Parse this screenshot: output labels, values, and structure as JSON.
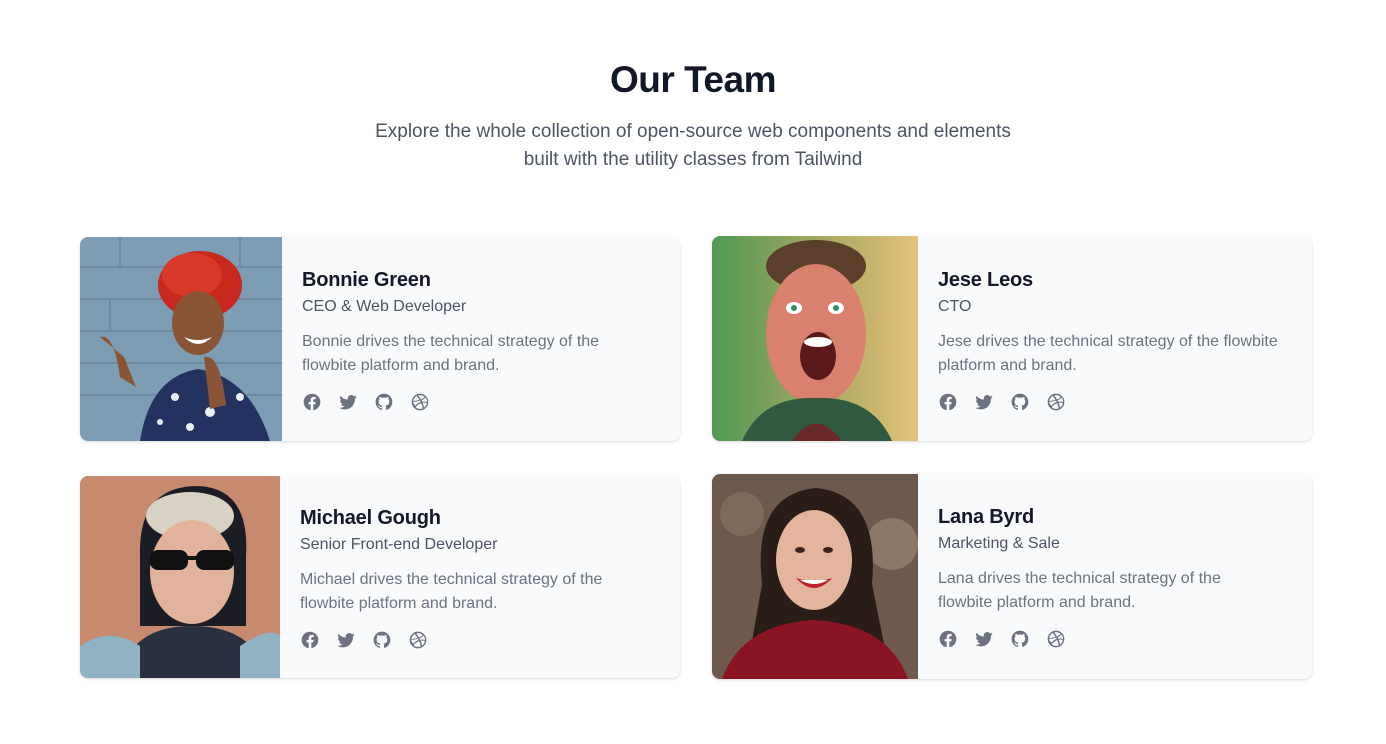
{
  "header": {
    "title": "Our Team",
    "subtitle": "Explore the whole collection of open-source web components and elements built with the utility classes from Tailwind"
  },
  "members": [
    {
      "name": "Bonnie Green",
      "role": "CEO & Web Developer",
      "description": "Bonnie drives the technical strategy of the flowbite platform and brand.",
      "socials": [
        "facebook-icon",
        "twitter-icon",
        "github-icon",
        "dribbble-icon"
      ]
    },
    {
      "name": "Jese Leos",
      "role": "CTO",
      "description": "Jese drives the technical strategy of the flowbite platform and brand.",
      "socials": [
        "facebook-icon",
        "twitter-icon",
        "github-icon",
        "dribbble-icon"
      ]
    },
    {
      "name": "Michael Gough",
      "role": "Senior Front-end Developer",
      "description": "Michael drives the technical strategy of the flowbite platform and brand.",
      "socials": [
        "facebook-icon",
        "twitter-icon",
        "github-icon",
        "dribbble-icon"
      ]
    },
    {
      "name": "Lana Byrd",
      "role": "Marketing & Sale",
      "description": "Lana drives the technical strategy of the flowbite platform and brand.",
      "socials": [
        "facebook-icon",
        "twitter-icon",
        "github-icon",
        "dribbble-icon"
      ]
    }
  ],
  "colors": {
    "card_background": "#f9fafb",
    "heading": "#111827",
    "body_text": "#6b7280",
    "icon": "#6b7280"
  }
}
